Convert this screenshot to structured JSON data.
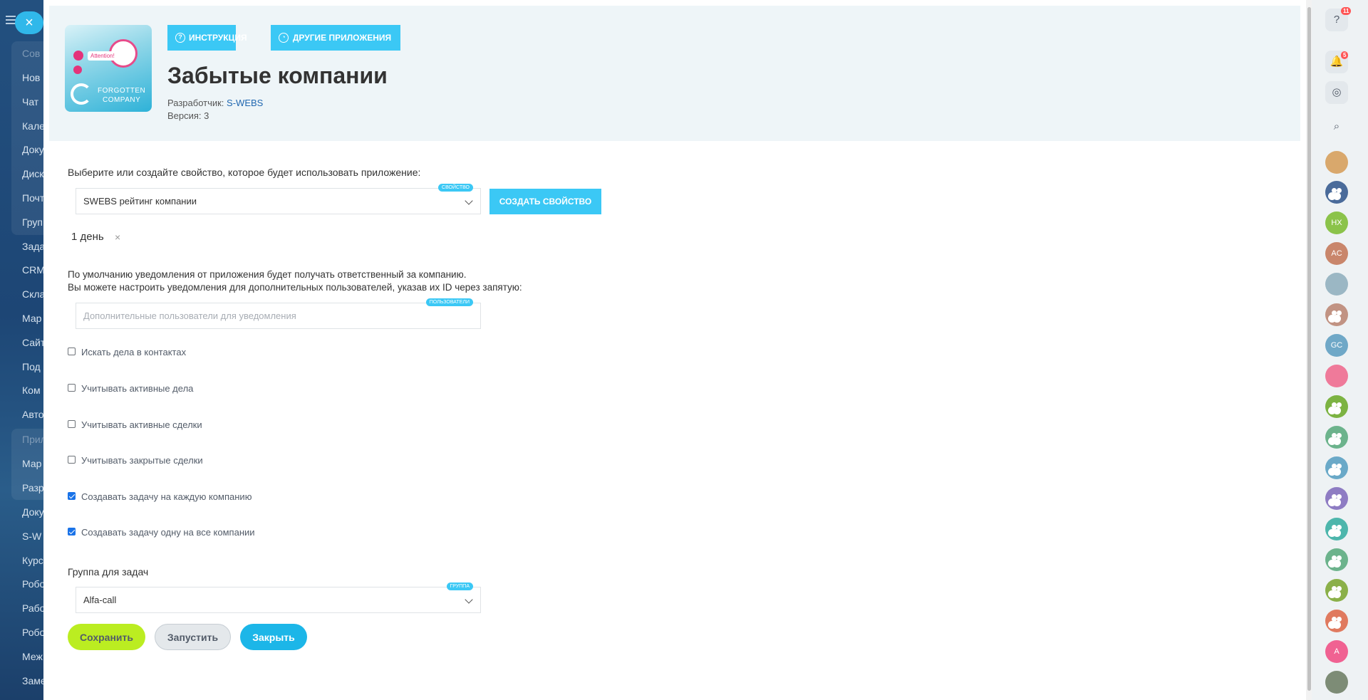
{
  "left_nav": {
    "close_label": "×",
    "items": [
      "Сов",
      "Нов",
      "Чат",
      "Кале",
      "Доку",
      "Диск",
      "Почт",
      "Груп",
      "Зада",
      "CRM",
      "Скла",
      "Мар",
      "Сайт",
      "Под",
      "Ком",
      "Авто",
      "Прил",
      "Мар",
      "Разр",
      "Доку",
      "S-W",
      "Курс",
      "Робо",
      "Рабо",
      "Робо",
      "Меж",
      "Заме"
    ]
  },
  "header": {
    "buttons": {
      "instruction": "Инструкция",
      "other_apps": "Другие приложения"
    },
    "logo": {
      "attention": "Attention!",
      "line1": "FORGOTTEN",
      "line2": "COMPANY"
    },
    "title": "Забытые компании",
    "developer_label": "Разработчик:",
    "developer_name": "S-WEBS",
    "version_label": "Версия: 3"
  },
  "property": {
    "prompt": "Выберите или создайте свойство, которое будет использовать приложение:",
    "selected": "SWEBS рейтинг компании",
    "tag": "свойство",
    "create_button": "Создать свойство",
    "chip": "1 день",
    "chip_remove": "×"
  },
  "notifications": {
    "line1": "По умолчанию уведомления от приложения будет получать ответственный за компанию.",
    "line2": "Вы можете настроить уведомления для дополнительных пользователей, указав их ID через запятую:",
    "placeholder": "Дополнительные пользователи для уведомления",
    "tag": "пользователи"
  },
  "options": [
    {
      "label": "Искать дела в контактах",
      "checked": false
    },
    {
      "label": "Учитывать активные дела",
      "checked": false
    },
    {
      "label": "Учитывать активные сделки",
      "checked": false
    },
    {
      "label": "Учитывать закрытые сделки",
      "checked": false
    },
    {
      "label": "Создавать задачу на каждую компанию",
      "checked": true
    },
    {
      "label": "Создавать задачу одну на все компании",
      "checked": true
    }
  ],
  "task_group": {
    "label": "Группа для задач",
    "selected": "Alfa-call",
    "tag": "группа"
  },
  "actions": {
    "save": "Сохранить",
    "run": "Запустить",
    "close": "Закрыть"
  },
  "right_bar": {
    "help_badge": "11",
    "notif_badge": "5",
    "avatars": [
      "HX",
      "AC",
      "GC",
      "A"
    ],
    "colors": {
      "accent": "#3bc8f5",
      "save": "#bbed21",
      "close": "#1cb6e8"
    }
  }
}
